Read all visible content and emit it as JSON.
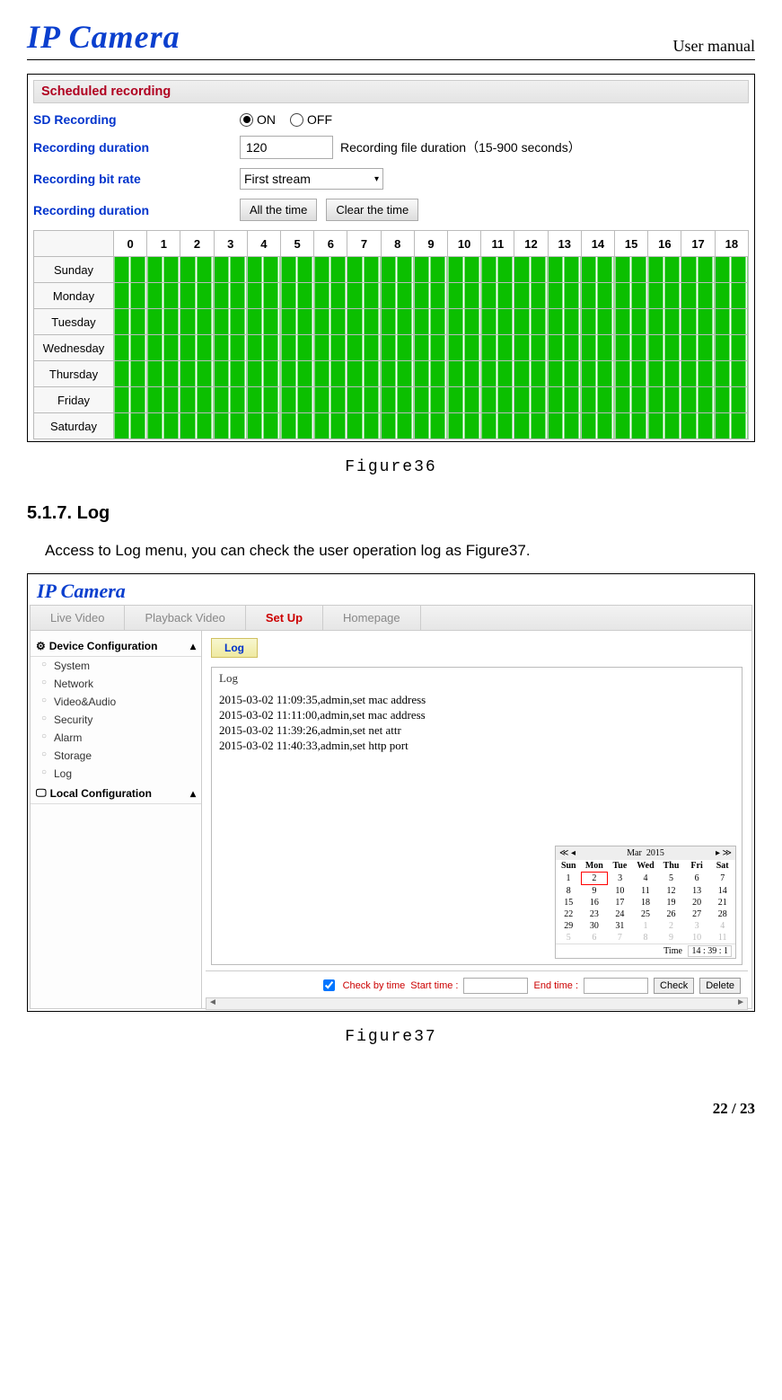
{
  "header": {
    "logo": "IP Camera",
    "right": "User manual"
  },
  "fig36": {
    "section_title": "Scheduled recording",
    "rows": {
      "sd_recording": {
        "label": "SD Recording",
        "on": "ON",
        "off": "OFF"
      },
      "duration": {
        "label": "Recording duration",
        "value": "120",
        "hint": "Recording file duration（15-900 seconds）"
      },
      "bitrate": {
        "label": "Recording bit rate",
        "value": "First stream"
      },
      "schedule": {
        "label": "Recording duration",
        "btn_all": "All the time",
        "btn_clear": "Clear the time"
      }
    },
    "hours": [
      "0",
      "1",
      "2",
      "3",
      "4",
      "5",
      "6",
      "7",
      "8",
      "9",
      "10",
      "11",
      "12",
      "13",
      "14",
      "15",
      "16",
      "17",
      "18"
    ],
    "days": [
      "Sunday",
      "Monday",
      "Tuesday",
      "Wednesday",
      "Thursday",
      "Friday",
      "Saturday"
    ],
    "caption": "Figure36"
  },
  "section_517": {
    "heading": "5.1.7. Log",
    "body": "Access to Log menu, you can check the user operation log as Figure37."
  },
  "fig37": {
    "logo": "IP Camera",
    "tabs": [
      "Live Video",
      "Playback Video",
      "Set Up",
      "Homepage"
    ],
    "sidebar": {
      "group1": "Device Configuration",
      "items": [
        "System",
        "Network",
        "Video&Audio",
        "Security",
        "Alarm",
        "Storage",
        "Log"
      ],
      "group2": "Local Configuration"
    },
    "log_tab": "Log",
    "log_title": "Log",
    "log_lines": [
      "2015-03-02 11:09:35,admin,set mac address",
      "2015-03-02 11:11:00,admin,set mac address",
      "2015-03-02 11:39:26,admin,set net attr",
      "2015-03-02 11:40:33,admin,set http port"
    ],
    "calendar": {
      "month": "Mar",
      "year": "2015",
      "dow": [
        "Sun",
        "Mon",
        "Tue",
        "Wed",
        "Thu",
        "Fri",
        "Sat"
      ],
      "weeks": [
        [
          "1",
          "2",
          "3",
          "4",
          "5",
          "6",
          "7"
        ],
        [
          "8",
          "9",
          "10",
          "11",
          "12",
          "13",
          "14"
        ],
        [
          "15",
          "16",
          "17",
          "18",
          "19",
          "20",
          "21"
        ],
        [
          "22",
          "23",
          "24",
          "25",
          "26",
          "27",
          "28"
        ],
        [
          "29",
          "30",
          "31",
          "1",
          "2",
          "3",
          "4"
        ],
        [
          "5",
          "6",
          "7",
          "8",
          "9",
          "10",
          "11"
        ]
      ],
      "selected": "2",
      "time_label": "Time",
      "time_value": "14 : 39 : 1"
    },
    "footer": {
      "check_by_time": "Check by time",
      "start": "Start time :",
      "end": "End time :",
      "check": "Check",
      "delete": "Delete"
    },
    "caption": "Figure37"
  },
  "footer": {
    "pagenum": "22 / 23"
  }
}
